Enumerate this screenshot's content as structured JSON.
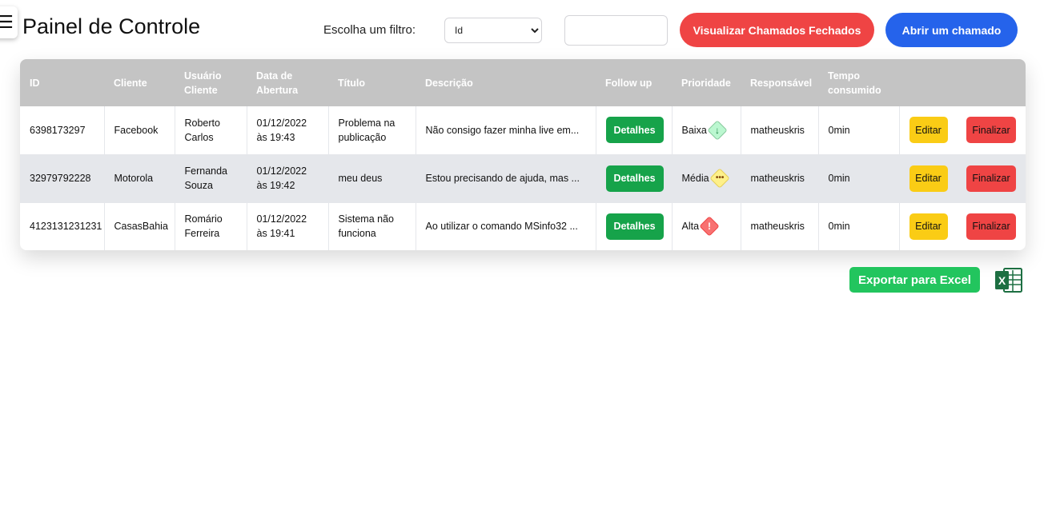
{
  "header": {
    "title": "Painel de Controle",
    "menu_icon": "hamburger-menu-icon",
    "filter_label": "Escolha um filtro:",
    "filter_selected": "Id",
    "search_value": "",
    "btn_closed_label": "Visualizar Chamados Fechados",
    "btn_open_label": "Abrir um chamado"
  },
  "colors": {
    "header_row_bg": "#c4c4c4",
    "danger": "#ef4444",
    "primary": "#2563eb",
    "success": "#16a34a",
    "warning": "#facc15",
    "export_green": "#22c55e"
  },
  "table": {
    "columns": [
      "ID",
      "Cliente",
      "Usuário Cliente",
      "Data de Abertura",
      "Título",
      "Descrição",
      "Follow up",
      "Prioridade",
      "Responsável",
      "Tempo consumido",
      "",
      ""
    ],
    "rows": [
      {
        "id": "6398173297",
        "cliente": "Facebook",
        "usuario": "Roberto Carlos",
        "data": "01/12/2022 às 19:43",
        "titulo": "Problema na publicação",
        "descricao": "Não consigo fazer minha live em...",
        "follow_label": "Detalhes",
        "prioridade": "Baixa",
        "prio_icon": "arrow-down-icon",
        "responsavel": "matheuskris",
        "tempo": "0min",
        "editar": "Editar",
        "finalizar": "Finalizar"
      },
      {
        "id": "32979792228",
        "cliente": "Motorola",
        "usuario": "Fernanda Souza",
        "data": "01/12/2022 às 19:42",
        "titulo": "meu deus",
        "descricao": "Estou precisando de ajuda, mas ...",
        "follow_label": "Detalhes",
        "prioridade": "Média",
        "prio_icon": "ellipsis-icon",
        "responsavel": "matheuskris",
        "tempo": "0min",
        "editar": "Editar",
        "finalizar": "Finalizar"
      },
      {
        "id": "4123131231231",
        "cliente": "CasasBahia",
        "usuario": "Romário Ferreira",
        "data": "01/12/2022 às 19:41",
        "titulo": "Sistema não funciona",
        "descricao": "Ao utilizar o comando MSinfo32 ...",
        "follow_label": "Detalhes",
        "prioridade": "Alta",
        "prio_icon": "exclamation-icon",
        "responsavel": "matheuskris",
        "tempo": "0min",
        "editar": "Editar",
        "finalizar": "Finalizar"
      }
    ]
  },
  "export": {
    "label": "Exportar para Excel",
    "icon": "excel-icon"
  }
}
